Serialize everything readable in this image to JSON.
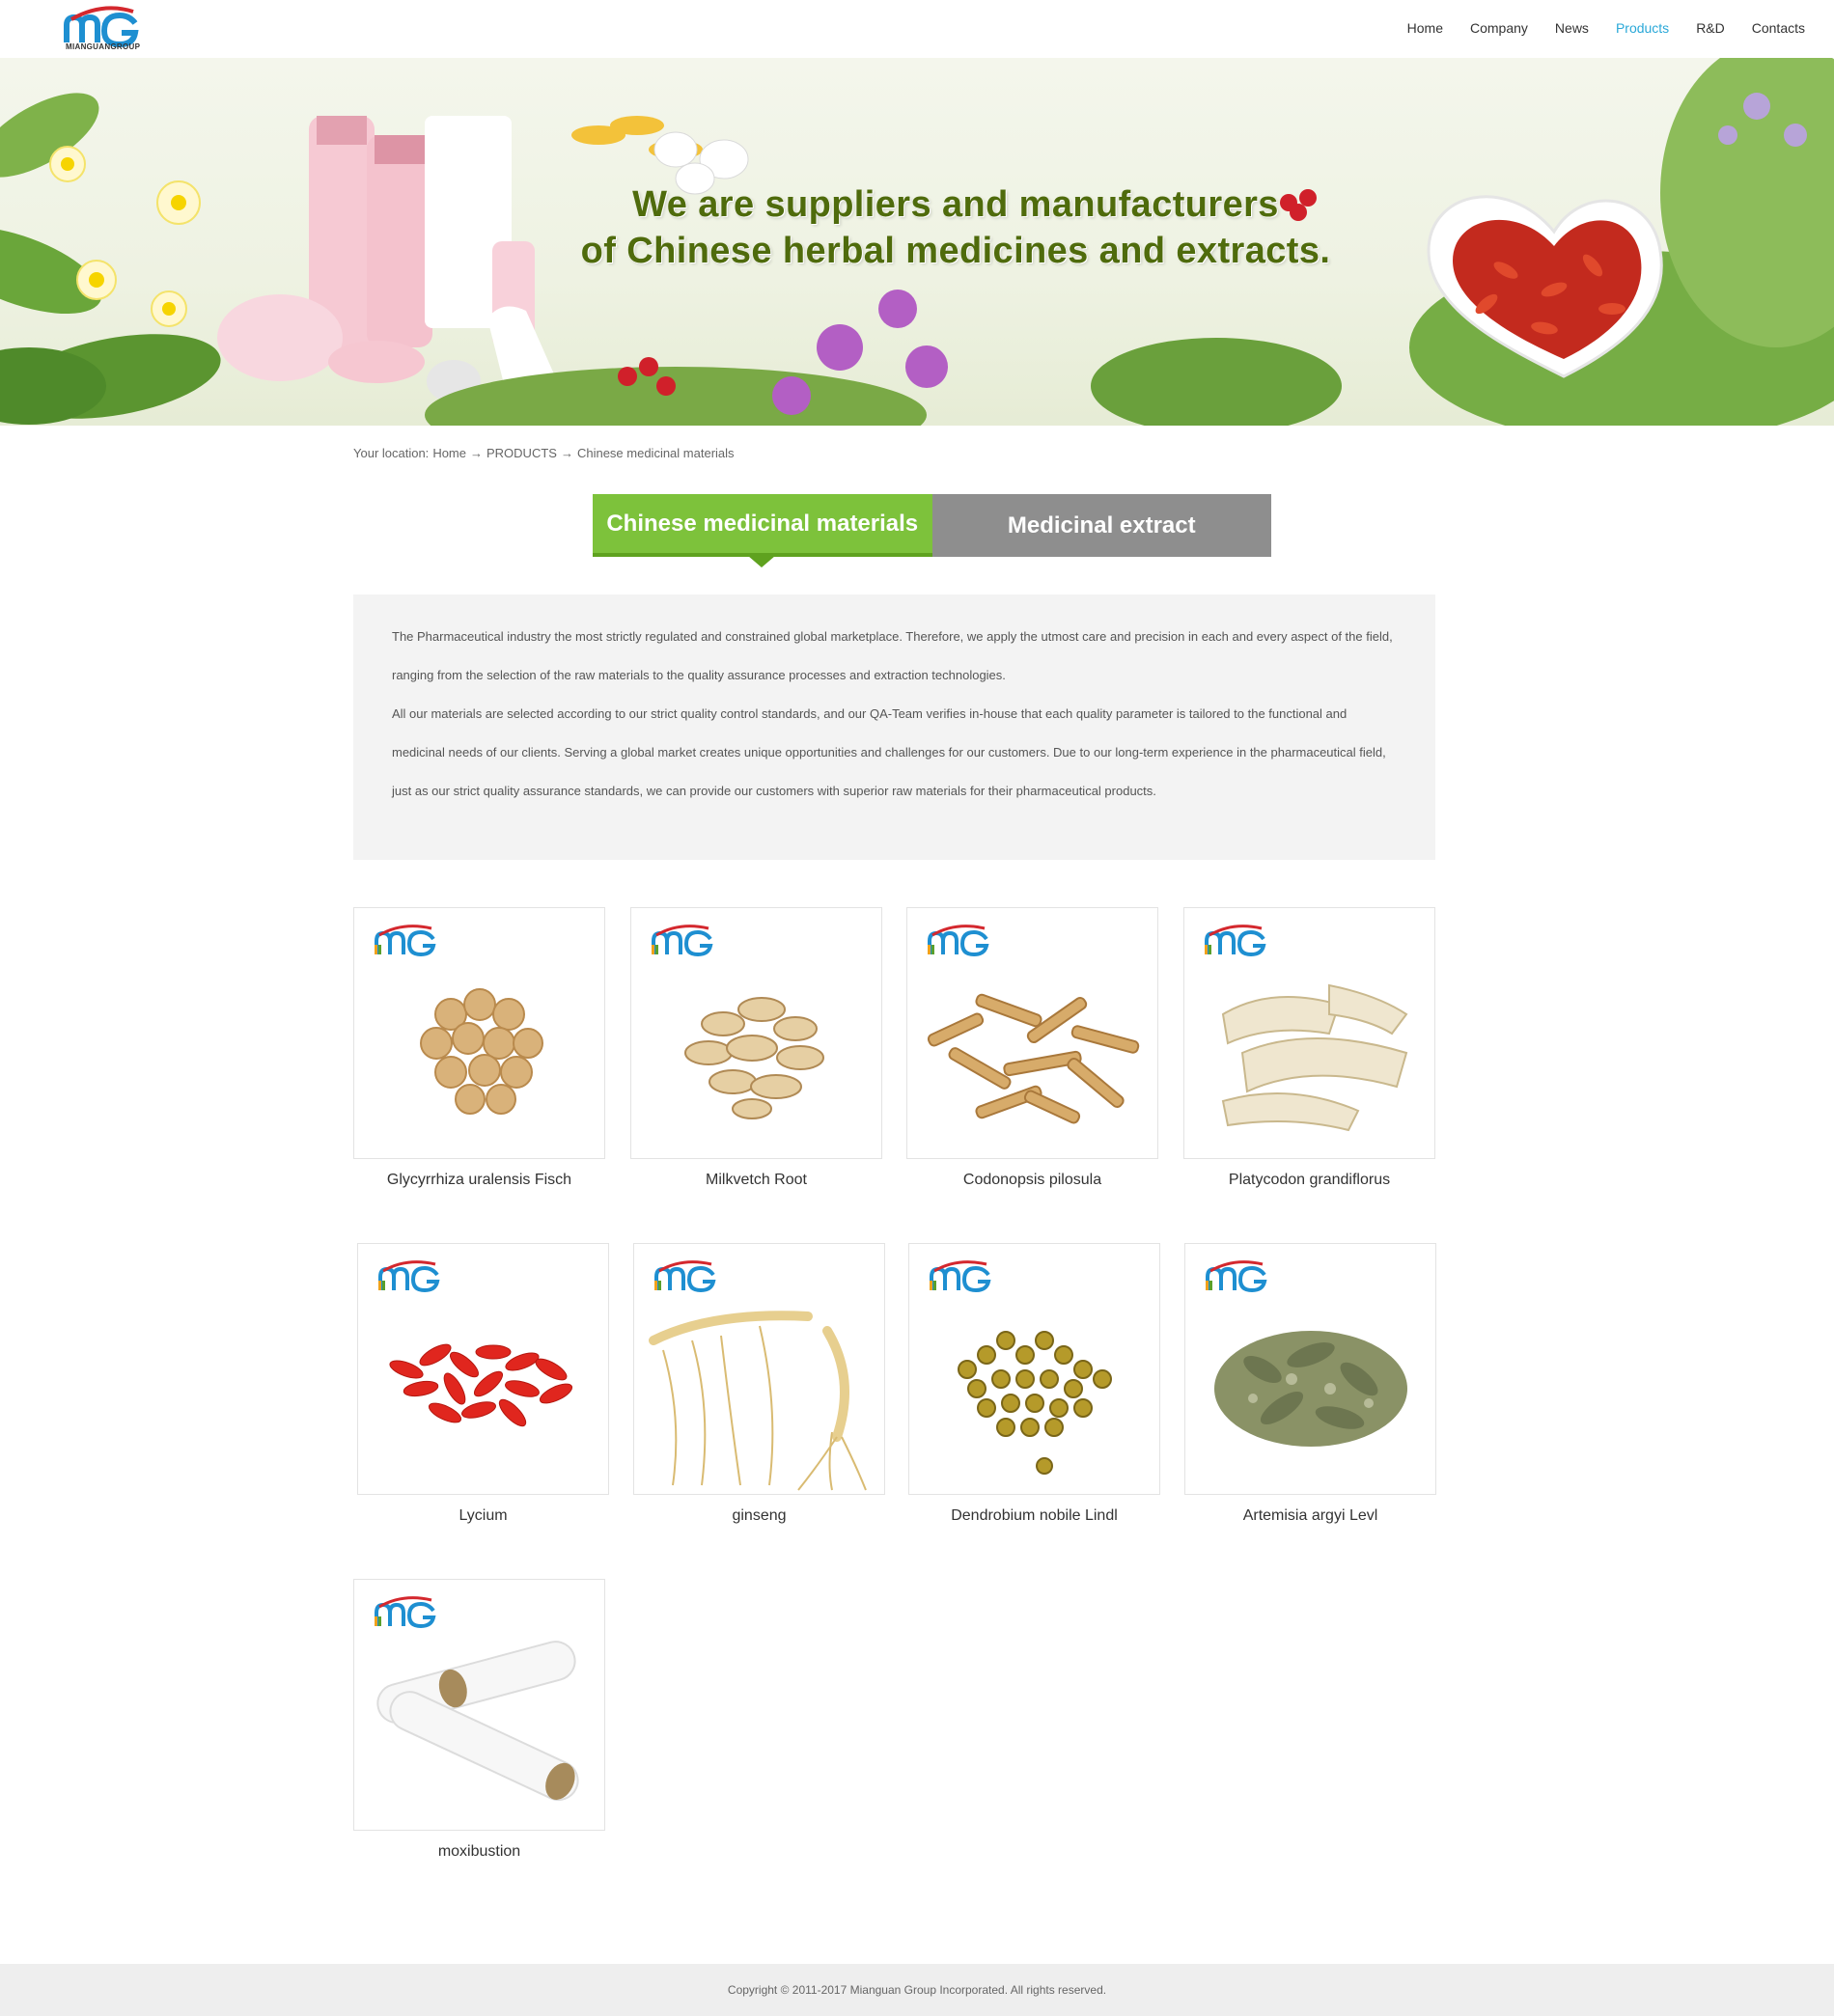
{
  "brand": {
    "logo_text": "MIANGUANGROUP",
    "accent": "#2aa8d8",
    "green": "#7dc23b"
  },
  "nav": {
    "items": [
      {
        "label": "Home"
      },
      {
        "label": "Company"
      },
      {
        "label": "News"
      },
      {
        "label": "Products"
      },
      {
        "label": "R&D"
      },
      {
        "label": "Contacts"
      }
    ],
    "active": "Products"
  },
  "banner": {
    "line1": "We are suppliers and manufacturers",
    "line2": "of Chinese herbal medicines and extracts."
  },
  "breadcrumb": {
    "prefix": "Your location:",
    "home": "Home",
    "arrow": "→",
    "products": "PRODUCTS",
    "current": "Chinese medicinal materials"
  },
  "tabs": [
    {
      "label": "Chinese medicinal materials",
      "active": true
    },
    {
      "label": "Medicinal extract",
      "active": false
    }
  ],
  "intro": {
    "p1": "The Pharmaceutical industry the most strictly regulated and constrained global marketplace. Therefore, we apply the utmost care and precision in each and every aspect of the field, ranging from the selection of the raw materials to the quality assurance processes and extraction technologies.",
    "p2": "All our materials are selected according to our strict quality control standards, and our QA-Team verifies in-house that each quality parameter is tailored to the functional and medicinal needs of our clients. Serving a global market creates unique opportunities and challenges for our customers. Due to our long-term experience in the pharmaceutical field, just as our strict quality assurance standards, we can provide our customers with superior raw materials for their pharmaceutical products."
  },
  "products": [
    {
      "name": "Glycyrrhiza uralensis Fisch"
    },
    {
      "name": "Milkvetch Root"
    },
    {
      "name": "Codonopsis pilosula"
    },
    {
      "name": "Platycodon grandiflorus"
    },
    {
      "name": "Lycium"
    },
    {
      "name": "ginseng"
    },
    {
      "name": "Dendrobium nobile Lindl"
    },
    {
      "name": "Artemisia argyi Levl"
    },
    {
      "name": "moxibustion"
    }
  ],
  "footer": {
    "copyright": "Copyright © 2011-2017 Mianguan Group Incorporated. All rights reserved."
  }
}
